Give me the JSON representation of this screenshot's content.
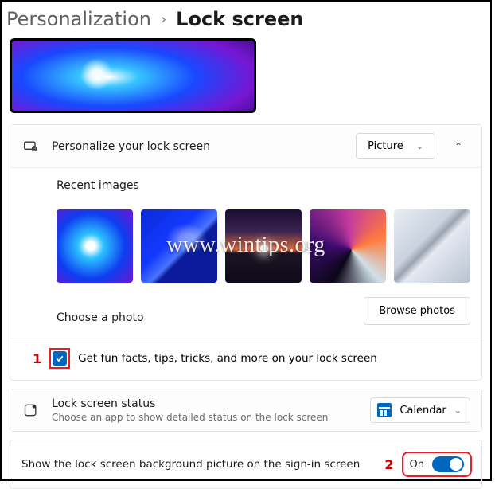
{
  "breadcrumb": {
    "parent": "Personalization",
    "current": "Lock screen"
  },
  "personalize": {
    "title": "Personalize your lock screen",
    "dropdown_value": "Picture",
    "recent_label": "Recent images",
    "choose_label": "Choose a photo",
    "browse_label": "Browse photos",
    "funfacts_label": "Get fun facts, tips, tricks, and more on your lock screen",
    "funfacts_checked": true
  },
  "status": {
    "title": "Lock screen status",
    "sub": "Choose an app to show detailed status on the lock screen",
    "app": "Calendar"
  },
  "signin": {
    "label": "Show the lock screen background picture on the sign-in screen",
    "state_label": "On",
    "state_on": true
  },
  "annotations": {
    "one": "1",
    "two": "2"
  },
  "watermark": "www.wintips.org"
}
